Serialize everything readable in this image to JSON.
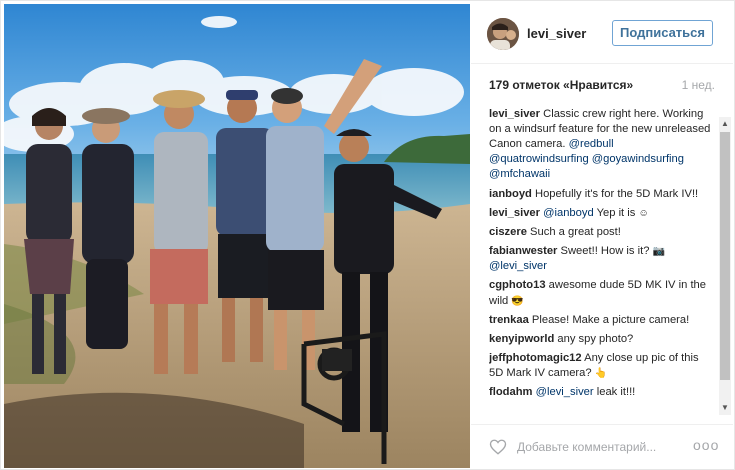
{
  "post": {
    "username": "levi_siver",
    "follow_label": "Подписаться",
    "likes": "179 отметок «Нравится»",
    "time_ago": "1 нед.",
    "comment_placeholder": "Добавьте комментарий...",
    "more_label": "ooo"
  },
  "comments": [
    {
      "user": "levi_siver",
      "text": " Classic crew right here. Working on a windsurf feature for the new unreleased Canon camera. ",
      "mentions": [
        "@redbull",
        "@quatrowindsurfing",
        "@goyawindsurfing",
        "@mfchawaii"
      ]
    },
    {
      "user": "ianboyd",
      "text": " Hopefully it's for the 5D Mark IV!!"
    },
    {
      "user": "levi_siver",
      "mention": "@ianboyd",
      "text": " Yep it is ",
      "emoji": "☺"
    },
    {
      "user": "ciszere",
      "text": " Such a great post!"
    },
    {
      "user": "fabianwester",
      "text": " Sweet!! How is it? ",
      "emoji": "📷",
      "mention_after": "@levi_siver"
    },
    {
      "user": "cgphoto13",
      "text": " awesome dude 5D MK IV in the wild ",
      "emoji": "😎"
    },
    {
      "user": "trenkaa",
      "text": " Please! Make a picture camera!"
    },
    {
      "user": "kenyipworld",
      "text": " any spy photo?"
    },
    {
      "user": "jeffphotomagic12",
      "text": " Any close up pic of this 5D Mark IV camera? ",
      "emoji": "👆"
    },
    {
      "user": "flodahm",
      "mention": "@levi_siver",
      "text": " leak it!!!"
    }
  ],
  "scrollbar": {
    "up": "▲",
    "down": "▼"
  }
}
